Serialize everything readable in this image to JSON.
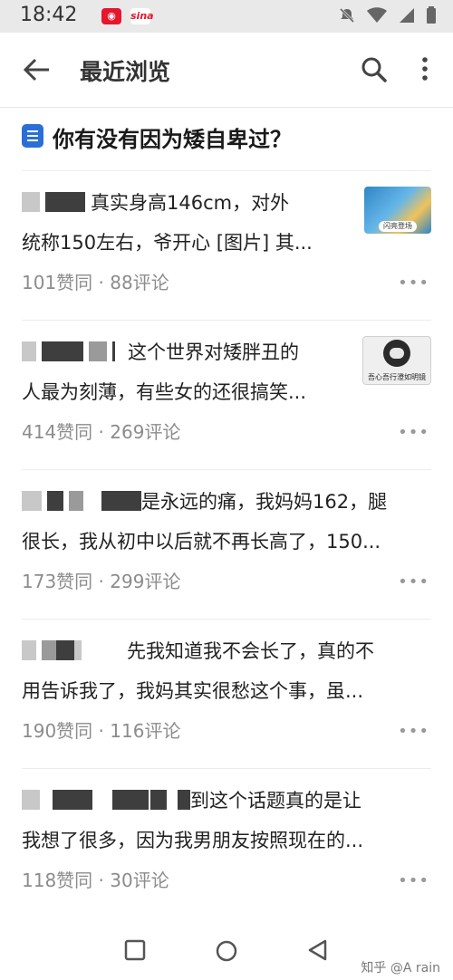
{
  "status_bar": {
    "time": "18:42",
    "app_icons": [
      "weibo-icon",
      "sina-icon"
    ],
    "sina_label": "sina",
    "right_icons": [
      "mute-icon",
      "wifi-icon",
      "signal-icon",
      "battery-icon"
    ]
  },
  "app_bar": {
    "title": "最近浏览",
    "left_icon": "back-arrow-icon",
    "right_icons": [
      "search-icon",
      "more-vertical-icon"
    ]
  },
  "question": {
    "icon": "question-doc-icon",
    "title": "你有没有因为矮自卑过？"
  },
  "answers": [
    {
      "line1": "真实身高146cm，对外",
      "line2": "统称150左右，爷开心 [图片] 其...",
      "votes": "101赞同",
      "comments": "88评论",
      "thumbnail_caption": "闪亮登场"
    },
    {
      "line1": "这个世界对矮胖丑的",
      "line2": "人最为刻薄，有些女的还很搞笑...",
      "votes": "414赞同",
      "comments": "269评论",
      "thumbnail_caption": "吾心吾行澄如明镜"
    },
    {
      "line1": "是永远的痛，我妈妈162，腿",
      "line2": "很长，我从初中以后就不再长高了，150...",
      "votes": "173赞同",
      "comments": "299评论"
    },
    {
      "line1": "先我知道我不会长了，真的不",
      "line2": "用告诉我了，我妈其实很愁这个事，虽...",
      "votes": "190赞同",
      "comments": "116评论"
    },
    {
      "line1": "到这个话题真的是让",
      "line2": "我想了很多，因为我男朋友按照现在的...",
      "votes": "118赞同",
      "comments": "30评论"
    }
  ],
  "meta_separator": " · ",
  "more_glyph": "•••",
  "nav_bar": {
    "icons": [
      "recents-square-icon",
      "home-circle-icon",
      "back-triangle-icon"
    ]
  },
  "watermark": "知乎 @A rain",
  "colors": {
    "question_icon": "#2b6fd6",
    "meta_text": "#8c8c8c",
    "status_bar_bg": "#e9e9e9"
  }
}
